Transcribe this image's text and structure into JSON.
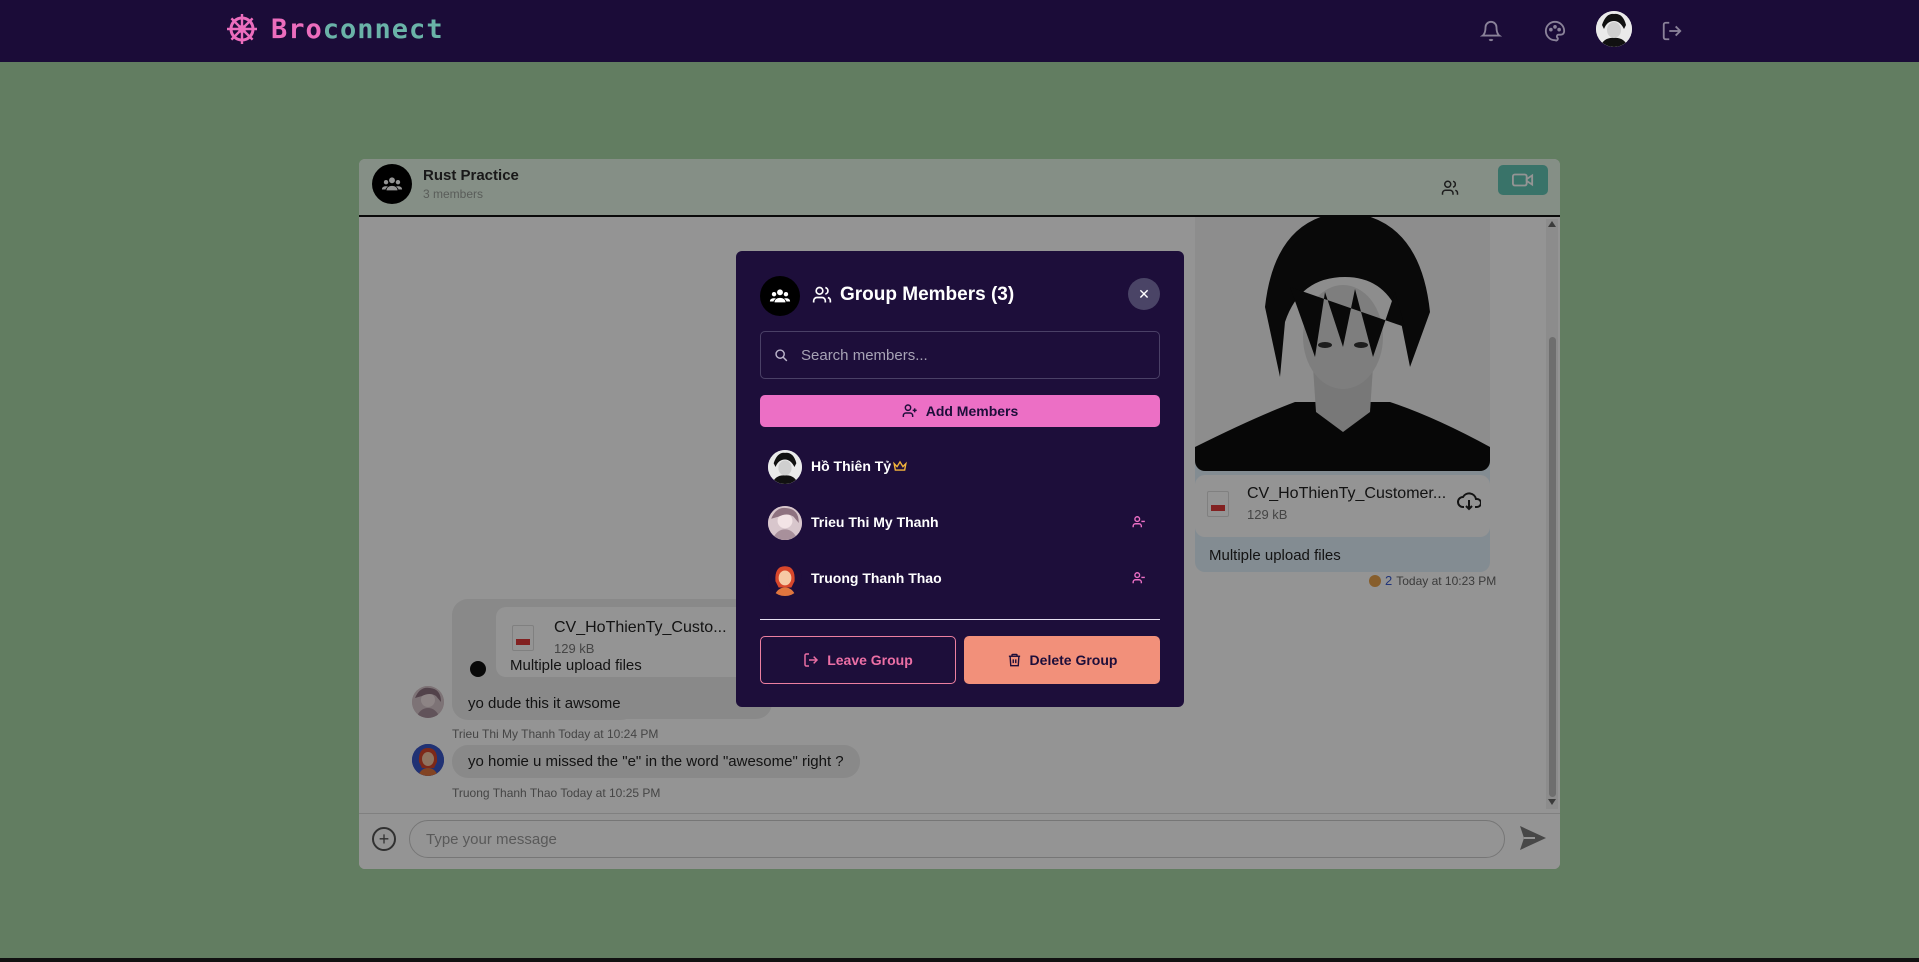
{
  "brand": {
    "part1": "Bro",
    "part2": "connect"
  },
  "navbar": {
    "icons": [
      "bell-icon",
      "palette-icon",
      "user-avatar",
      "logout-icon"
    ]
  },
  "chat": {
    "group_name": "Rust Practice",
    "group_sub": "3 members",
    "right_file": {
      "name": "CV_HoThienTy_Customer...",
      "size": "129 kB"
    },
    "right_caption": "Multiple upload files",
    "right_seen_count": "2",
    "right_time": "Today at 10:23 PM",
    "left_file": {
      "name": "CV_HoThienTy_Custo...",
      "size": "129 kB"
    },
    "left_caption": "Multiple upload files",
    "messages": [
      {
        "text": "yo dude this it awsome",
        "author": "Trieu Thi My Thanh",
        "time": "Today at 10:24 PM"
      },
      {
        "text": "yo homie u missed the \"e\" in the word \"awesome\" right ?",
        "author": "Truong Thanh Thao",
        "time": "Today at 10:25 PM"
      }
    ],
    "input_placeholder": "Type your message"
  },
  "modal": {
    "title": "Group Members (3)",
    "search_placeholder": "Search members...",
    "add_label": "Add Members",
    "members": [
      {
        "name": "Hồ Thiên Tỷ",
        "role": "owner"
      },
      {
        "name": "Trieu Thi My Thanh",
        "role": "member"
      },
      {
        "name": "Truong Thanh Thao",
        "role": "member"
      }
    ],
    "leave_label": "Leave Group",
    "delete_label": "Delete Group"
  },
  "colors": {
    "nav": "#1b0c38",
    "accent_pink": "#ec6fc5",
    "accent_teal": "#62c7b6",
    "danger": "#f2907a"
  }
}
